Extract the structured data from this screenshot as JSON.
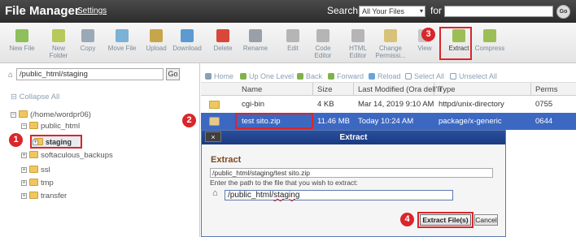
{
  "header": {
    "title": "File Manager",
    "settings_label": "Settings",
    "search_label": "Search",
    "search_scope": "All Your Files",
    "for_label": "for",
    "go_label": "Go"
  },
  "toolbar": {
    "items": [
      {
        "label": "New File",
        "icon": "new-file-icon",
        "color": "#8dbf5a"
      },
      {
        "label": "New\nFolder",
        "icon": "new-folder-icon",
        "color": "#b7c95a"
      },
      {
        "label": "Copy",
        "icon": "copy-icon",
        "color": "#9aa9b8"
      },
      {
        "label": "Move File",
        "icon": "move-file-icon",
        "color": "#7bb2d6"
      },
      {
        "label": "Upload",
        "icon": "upload-icon",
        "color": "#c7a64b"
      },
      {
        "label": "Download",
        "icon": "download-icon",
        "color": "#5c9ad1"
      },
      {
        "label": "Delete",
        "icon": "delete-icon",
        "color": "#d9463a"
      },
      {
        "label": "Rename",
        "icon": "rename-icon",
        "color": "#9aa0a8"
      },
      {
        "label": "Edit",
        "icon": "edit-icon",
        "color": "#b5b5b5"
      },
      {
        "label": "Code\nEditor",
        "icon": "code-editor-icon",
        "color": "#b5b5b5"
      },
      {
        "label": "HTML\nEditor",
        "icon": "html-editor-icon",
        "color": "#b5b5b5"
      },
      {
        "label": "Change\nPermissi...",
        "icon": "key-icon",
        "color": "#d8c27a"
      },
      {
        "label": "View",
        "icon": "view-icon",
        "color": "#c7c7c7"
      },
      {
        "label": "Extract",
        "icon": "extract-icon",
        "color": "#9bbf55"
      },
      {
        "label": "Compress",
        "icon": "compress-icon",
        "color": "#9bbf55"
      }
    ]
  },
  "left_panel": {
    "path_value": "/public_html/staging",
    "go_label": "Go",
    "collapse_all": "Collapse All",
    "tree": {
      "home": "(/home/wordpr06)",
      "public_html": "public_html",
      "staging": "staging",
      "softaculous": "softaculous_backups",
      "ssl": "ssl",
      "tmp": "tmp",
      "transfer": "transfer"
    }
  },
  "file_toolbar": {
    "home": "Home",
    "up_one_level": "Up One Level",
    "back": "Back",
    "forward": "Forward",
    "reload": "Reload",
    "select_all": "Select All",
    "unselect_all": "Unselect All"
  },
  "table": {
    "headers": {
      "name": "Name",
      "size": "Size",
      "modified": "Last Modified (Ora dell'Ir",
      "type": "Type",
      "perms": "Perms"
    },
    "rows": [
      {
        "name": "cgi-bin",
        "size": "4 KB",
        "modified": "Mar 14, 2019 9:10 AM",
        "type": "httpd/unix-directory",
        "perms": "0755"
      },
      {
        "name": "test sito.zip",
        "size": "11.46 MB",
        "modified": "Today 10:24 AM",
        "type": "package/x-generic",
        "perms": "0644"
      }
    ]
  },
  "dialog": {
    "title": "Extract",
    "close_label": "×",
    "heading": "Extract",
    "file_path": "/public_html/staging/test sito.zip",
    "instructions": "Enter the path to the file that you wish to extract:",
    "destination": "/public_html/staging",
    "extract_button": "Extract File(s)",
    "cancel_button": "Cancel"
  },
  "callouts": {
    "c1": "1",
    "c2": "2",
    "c3": "3",
    "c4": "4"
  },
  "colors": {
    "accent_red": "#d9262b",
    "selection_blue": "#3d68c2",
    "dialog_blue": "#2a4f9e"
  }
}
